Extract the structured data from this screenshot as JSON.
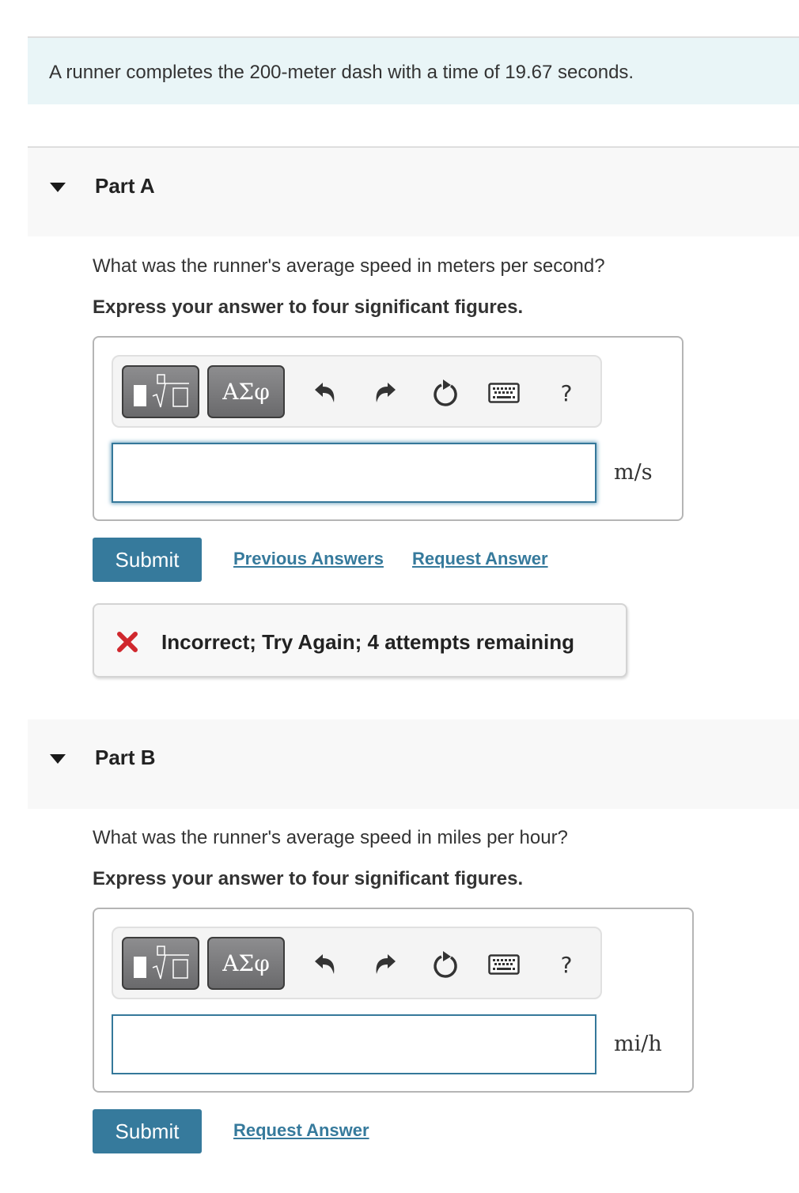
{
  "problem": {
    "statement": "A runner completes the 200-meter dash with a time of 19.67 seconds."
  },
  "parts": [
    {
      "title": "Part A",
      "expanded": true,
      "question": "What was the runner's average speed in meters per second?",
      "instruction": "Express your answer to four significant figures.",
      "toolbar": {
        "templates_icon": "templates-icon",
        "symbols_label": "ΑΣφ",
        "undo_icon": "undo-icon",
        "redo_icon": "redo-icon",
        "reset_icon": "reset-icon",
        "keyboard_icon": "keyboard-icon",
        "help_label": "?"
      },
      "answer_value": "",
      "unit": "m/s",
      "submit_label": "Submit",
      "links": [
        "Previous Answers",
        "Request Answer"
      ],
      "feedback": {
        "status": "incorrect",
        "message": "Incorrect; Try Again; 4 attempts remaining",
        "color": "#d0282e"
      }
    },
    {
      "title": "Part B",
      "expanded": true,
      "question": "What was the runner's average speed in miles per hour?",
      "instruction": "Express your answer to four significant figures.",
      "toolbar": {
        "templates_icon": "templates-icon",
        "symbols_label": "ΑΣφ",
        "undo_icon": "undo-icon",
        "redo_icon": "redo-icon",
        "reset_icon": "reset-icon",
        "keyboard_icon": "keyboard-icon",
        "help_label": "?"
      },
      "answer_value": "",
      "unit": "mi/h",
      "submit_label": "Submit",
      "links": [
        "Request Answer"
      ]
    }
  ],
  "colors": {
    "accent": "#367a9c",
    "intro_bg": "#e9f5f7",
    "part_header_bg": "#f8f8f8",
    "error": "#d0282e"
  }
}
